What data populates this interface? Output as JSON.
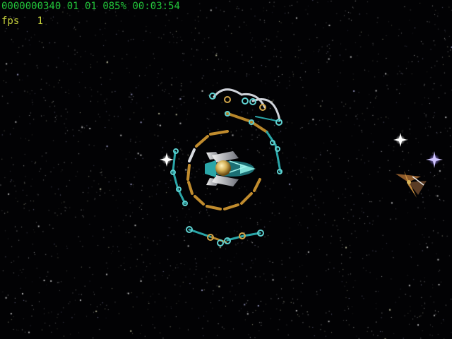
{
  "hud": {
    "score": "0000000340",
    "stage": "01",
    "lives": "01",
    "shield": "085%",
    "timer": "00:03:54",
    "fps_label": "fps",
    "fps_value": "1"
  },
  "colors": {
    "score_text": "#22c33a",
    "fps_text": "#c8d23c",
    "background": "#020204",
    "chain_cyan": "#2aa6a8",
    "chain_gold": "#b7862a",
    "ship_gold": "#d7b45a",
    "star_white": "#ffffff",
    "star_violet": "#b7a8ff"
  },
  "scene": {
    "player_ship": "teal-gold-starfighter",
    "player_shield": "segmented-orbit-shield",
    "enemy": "brown-winged-fighter",
    "sparkles": [
      "white-star-sparkle",
      "white-star-sparkle",
      "violet-star-sparkle"
    ]
  }
}
